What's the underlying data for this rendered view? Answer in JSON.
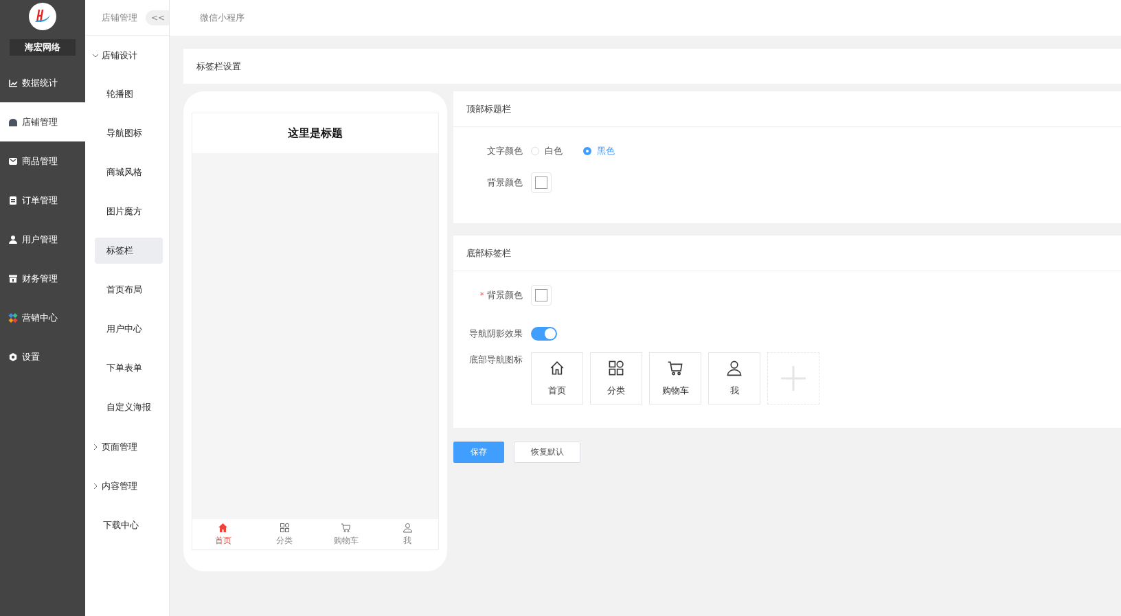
{
  "sidebar": {
    "brand": "海宏网络",
    "items": [
      {
        "label": "数据统计",
        "selected": false
      },
      {
        "label": "店铺管理",
        "selected": true
      },
      {
        "label": "商品管理",
        "selected": false
      },
      {
        "label": "订单管理",
        "selected": false
      },
      {
        "label": "用户管理",
        "selected": false
      },
      {
        "label": "财务管理",
        "selected": false
      },
      {
        "label": "营销中心",
        "selected": false
      },
      {
        "label": "设置",
        "selected": false
      }
    ]
  },
  "submenu": {
    "title": "店铺管理",
    "collapse_button": "<<",
    "items": [
      {
        "label": "店铺设计",
        "expanded": true,
        "children": [
          {
            "label": "轮播图",
            "selected": false
          },
          {
            "label": "导航图标",
            "selected": false
          },
          {
            "label": "商城风格",
            "selected": false
          },
          {
            "label": "图片魔方",
            "selected": false
          },
          {
            "label": "标签栏",
            "selected": true
          },
          {
            "label": "首页布局",
            "selected": false
          },
          {
            "label": "用户中心",
            "selected": false
          },
          {
            "label": "下单表单",
            "selected": false
          },
          {
            "label": "自定义海报",
            "selected": false
          }
        ]
      },
      {
        "label": "页面管理",
        "expanded": false
      },
      {
        "label": "内容管理",
        "expanded": false
      },
      {
        "label": "下载中心"
      }
    ]
  },
  "breadcrumb": "微信小程序",
  "section_title": "标签栏设置",
  "preview": {
    "title": "这里是标题",
    "tabs": [
      {
        "label": "首页",
        "selected": true
      },
      {
        "label": "分类",
        "selected": false
      },
      {
        "label": "购物车",
        "selected": false
      },
      {
        "label": "我",
        "selected": false
      }
    ]
  },
  "top_bar_panel": {
    "heading": "顶部标题栏",
    "text_color": {
      "label": "文字颜色",
      "options": [
        {
          "label": "白色",
          "selected": false
        },
        {
          "label": "黑色",
          "selected": true
        }
      ]
    },
    "background_color": {
      "label": "背景颜色"
    }
  },
  "bottom_bar_panel": {
    "heading": "底部标签栏",
    "background_color": {
      "required_mark": "*",
      "label": "背景颜色"
    },
    "shadow": {
      "label": "导航阴影效果",
      "on": true
    },
    "nav_icons": {
      "label": "底部导航图标",
      "items": [
        {
          "label": "首页"
        },
        {
          "label": "分类"
        },
        {
          "label": "购物车"
        },
        {
          "label": "我"
        }
      ]
    }
  },
  "buttons": [
    {
      "label": "保存",
      "kind": "primary"
    },
    {
      "label": "恢复默认",
      "kind": "default"
    }
  ]
}
